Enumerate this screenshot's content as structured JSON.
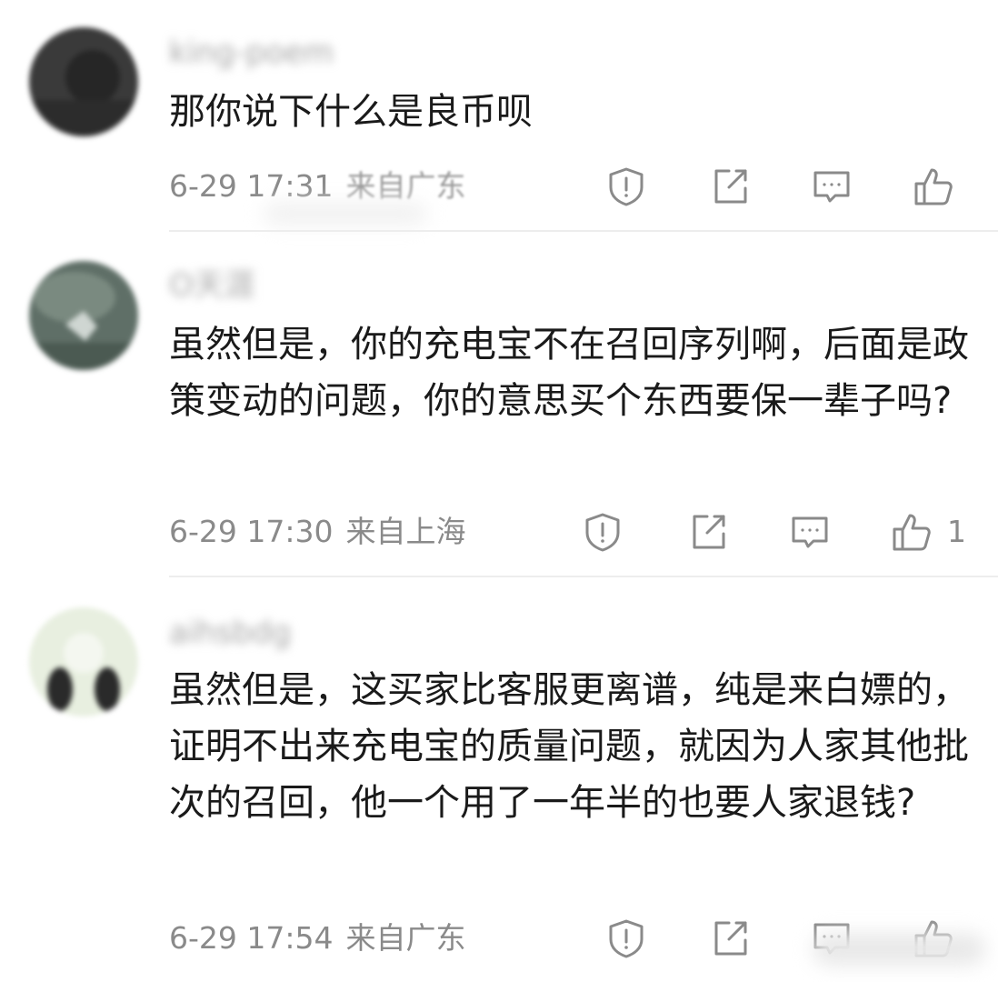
{
  "comments": [
    {
      "username": "king-poem",
      "text": "那你说下什么是良币呗",
      "time": "6-29 17:31",
      "location": "来自广东",
      "likes": ""
    },
    {
      "username": "O天涯",
      "text": "虽然但是，你的充电宝不在召回序列啊，后面是政策变动的问题，你的意思买个东西要保一辈子吗?",
      "time": "6-29 17:30",
      "location": "来自上海",
      "likes": "1"
    },
    {
      "username": "aihsbdg",
      "text": "虽然但是，这买家比客服更离谱，纯是来白嫖的，证明不出来充电宝的质量问题，就因为人家其他批次的召回，他一个用了一年半的也要人家退钱?",
      "time": "6-29 17:54",
      "location": "来自广东",
      "likes": ""
    }
  ],
  "icons": [
    "report-icon",
    "share-icon",
    "reply-icon",
    "like-icon"
  ],
  "colors": {
    "text": "#1a1a1a",
    "meta": "#8a8a8a",
    "icon": "#8a8a8a",
    "divider": "#ededed"
  },
  "watermark": ""
}
